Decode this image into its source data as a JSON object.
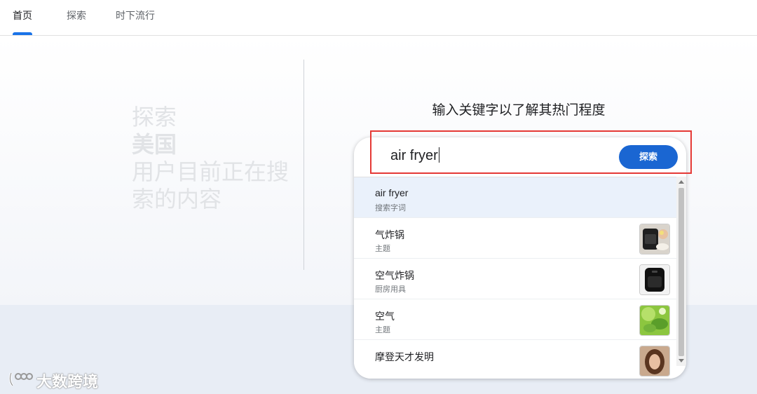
{
  "nav": {
    "tabs": [
      {
        "label": "首页",
        "active": true
      },
      {
        "label": "探索",
        "active": false
      },
      {
        "label": "时下流行",
        "active": false
      }
    ]
  },
  "hero": {
    "line1": "探索",
    "country": "美国",
    "line3a": "用户目前正在搜",
    "line3b": "索的内容"
  },
  "prompt": "输入关键字以了解其热门程度",
  "search": {
    "value": "air fryer",
    "button_label": "探索"
  },
  "suggestions": [
    {
      "title": "air fryer",
      "subtitle": "搜索字词",
      "image": null,
      "highlighted": true
    },
    {
      "title": "气炸锅",
      "subtitle": "主题",
      "image": "air-fryer-photo"
    },
    {
      "title": "空气炸锅",
      "subtitle": "厨房用具",
      "image": "black-air-fryer-photo"
    },
    {
      "title": "空气",
      "subtitle": "主题",
      "image": "green-leaves-photo"
    },
    {
      "title": "摩登天才发明",
      "subtitle": "",
      "image": "woman-portrait-photo"
    }
  ],
  "watermark": {
    "text": "大数跨境"
  },
  "colors": {
    "accent": "#1a73e8",
    "button": "#1a66d2",
    "highlight_border": "#e53935"
  }
}
